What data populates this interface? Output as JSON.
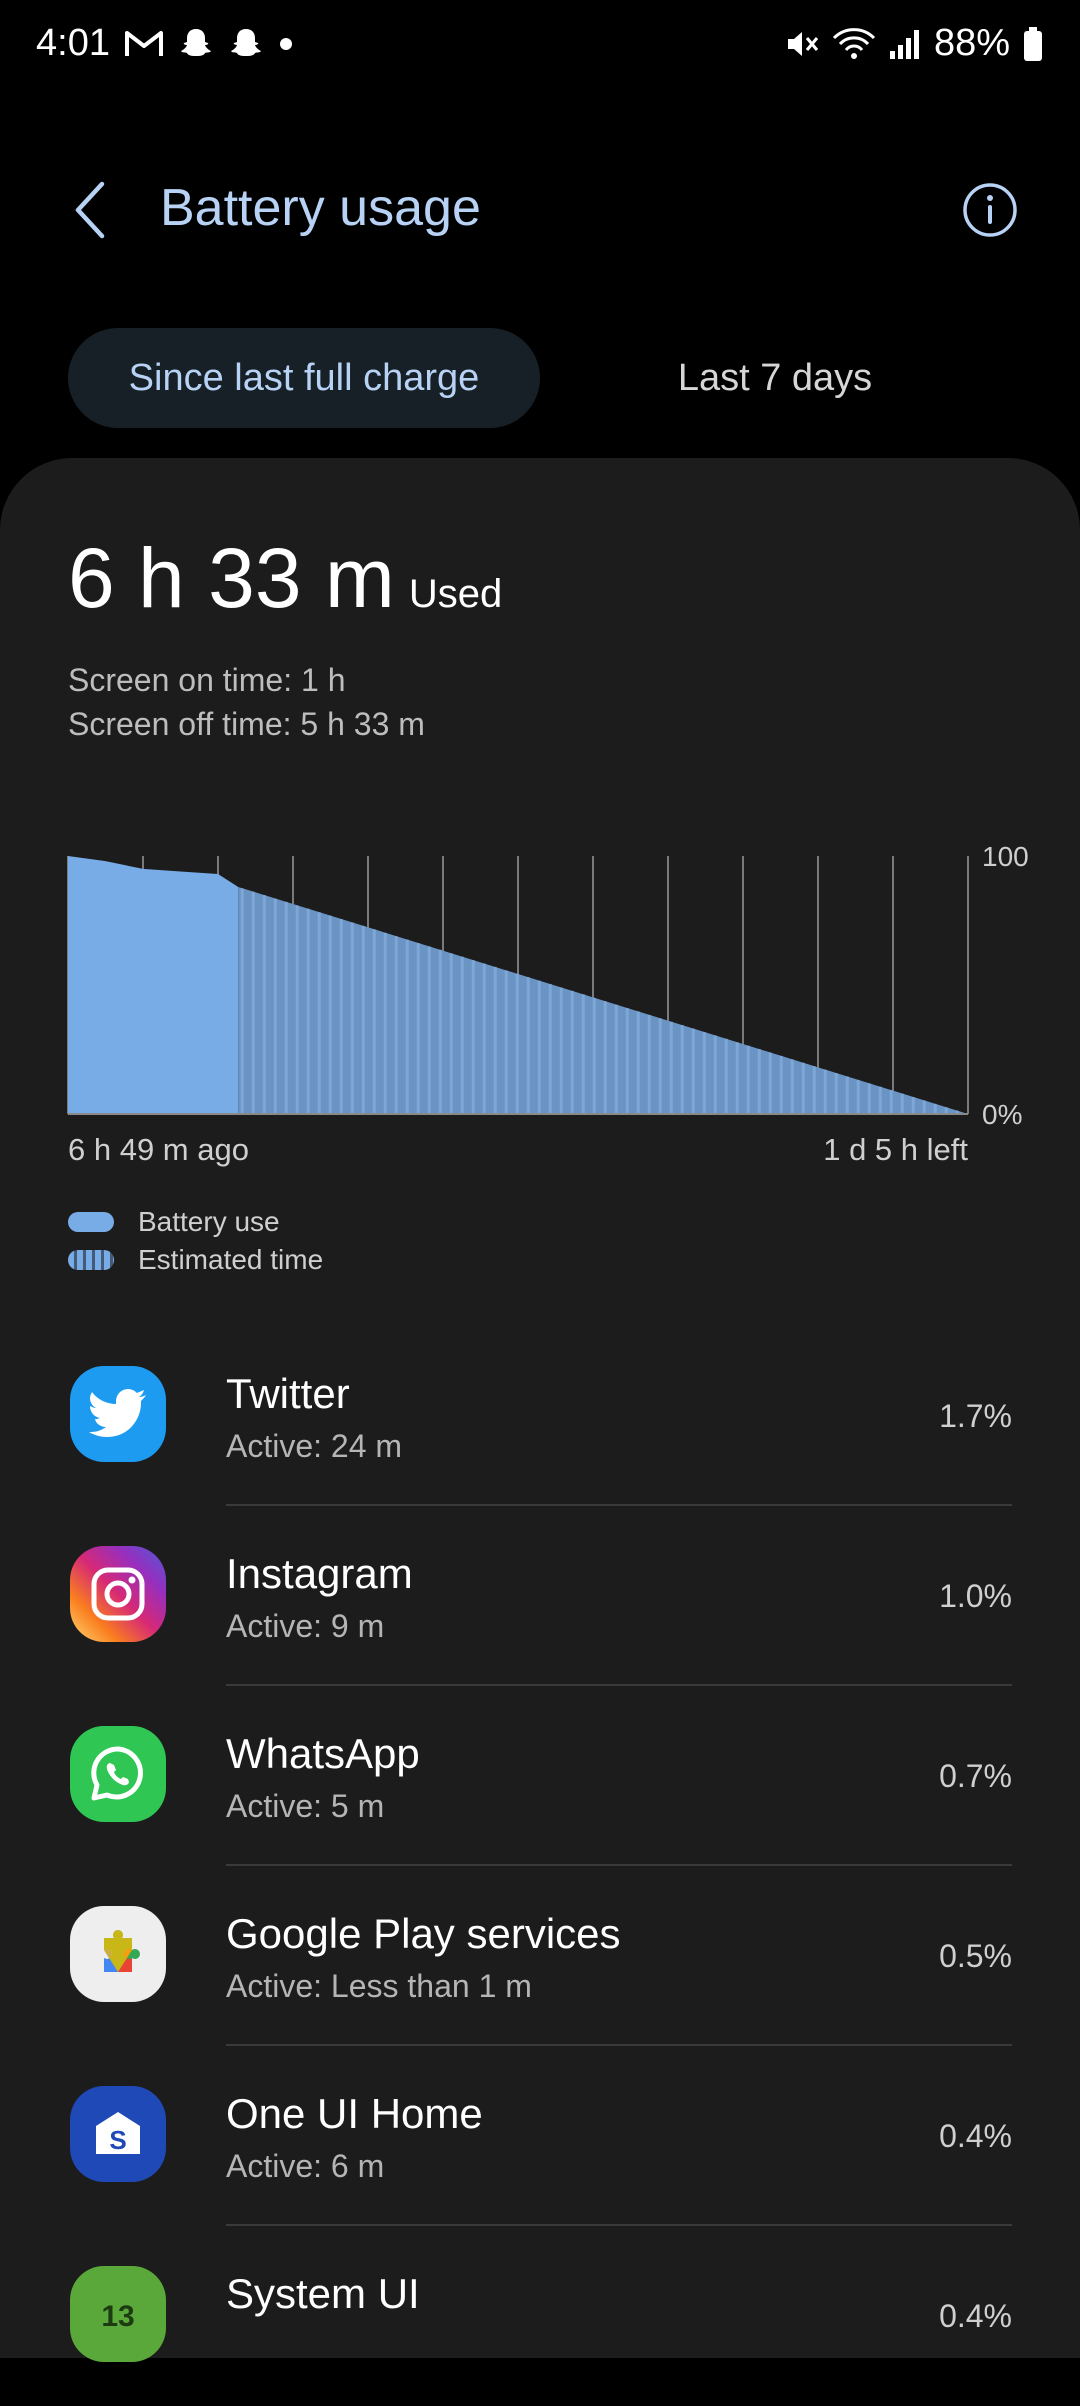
{
  "status_bar": {
    "time": "4:01",
    "battery_percent": "88%",
    "left_icons": [
      "gmail-icon",
      "snapchat-icon",
      "snapchat-icon",
      "dot-icon"
    ],
    "right_icons": [
      "mute-icon",
      "wifi-icon",
      "signal-icon",
      "battery-icon"
    ]
  },
  "header": {
    "title": "Battery usage"
  },
  "tabs": [
    {
      "label": "Since last full charge",
      "selected": true
    },
    {
      "label": "Last 7 days",
      "selected": false
    }
  ],
  "summary": {
    "used_value": "6 h 33 m",
    "used_label": "Used",
    "screen_on": "Screen on time: 1 h",
    "screen_off": "Screen off time: 5 h 33 m"
  },
  "chart_data": {
    "type": "area",
    "y_tick_labels": [
      "100",
      "0%"
    ],
    "ylim": [
      0,
      100
    ],
    "x_start_label": "6 h 49 m ago",
    "x_end_label": "1 d 5 h left",
    "series": [
      {
        "name": "Battery use",
        "x": [
          0,
          0.5,
          1,
          1.5,
          2,
          2.27
        ],
        "values": [
          100,
          98,
          95,
          94,
          93,
          88
        ]
      },
      {
        "name": "Estimated time",
        "x": [
          2.27,
          12.0
        ],
        "values": [
          88,
          0
        ]
      }
    ],
    "x_range": [
      0,
      12.0
    ],
    "grid": true,
    "colors": {
      "battery_use": "#78ace6",
      "estimated": "#6a94c4"
    }
  },
  "legend": {
    "battery_use": "Battery use",
    "estimated_time": "Estimated time"
  },
  "apps": [
    {
      "name": "Twitter",
      "active": "Active: 24 m",
      "percent": "1.7%",
      "icon": "twitter-icon"
    },
    {
      "name": "Instagram",
      "active": "Active: 9 m",
      "percent": "1.0%",
      "icon": "instagram-icon"
    },
    {
      "name": "WhatsApp",
      "active": "Active: 5 m",
      "percent": "0.7%",
      "icon": "whatsapp-icon"
    },
    {
      "name": "Google Play services",
      "active": "Active: Less than 1 m",
      "percent": "0.5%",
      "icon": "google-play-services-icon"
    },
    {
      "name": "One UI Home",
      "active": "Active: 6 m",
      "percent": "0.4%",
      "icon": "one-ui-home-icon"
    },
    {
      "name": "System UI",
      "active": "",
      "percent": "0.4%",
      "icon": "system-ui-icon"
    }
  ]
}
